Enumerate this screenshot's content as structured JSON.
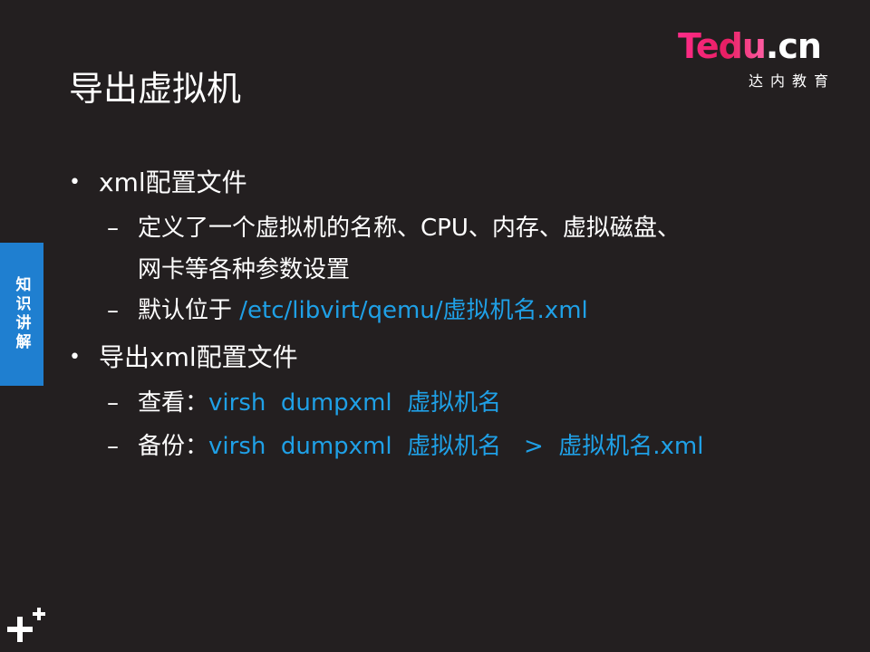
{
  "logo": {
    "brand_main": "Tedu",
    "brand_suffix": ".cn",
    "brand_sub": "达内教育",
    "brand_color": "#e81e63"
  },
  "title": "导出虚拟机",
  "side_tab": {
    "label": "知识讲解",
    "color": "#1f7fd0"
  },
  "bullets": [
    {
      "text": "xml配置文件",
      "subs": [
        {
          "line1": "定义了一个虚拟机的名称、CPU、内存、虚拟磁盘、",
          "line2": "网卡等各种参数设置"
        },
        {
          "prefix": "默认位于 ",
          "highlight": "/etc/libvirt/qemu/虚拟机名.xml"
        }
      ]
    },
    {
      "text": "导出xml配置文件",
      "subs": [
        {
          "prefix": "查看：",
          "highlight": "virsh  dumpxml  虚拟机名"
        },
        {
          "prefix": "备份：",
          "highlight": "virsh  dumpxml  虚拟机名   >  虚拟机名.xml"
        }
      ]
    }
  ],
  "colors": {
    "background": "#231f20",
    "accent_blue": "#1fa0e6"
  },
  "icons": {
    "corner": "plus-icon"
  }
}
